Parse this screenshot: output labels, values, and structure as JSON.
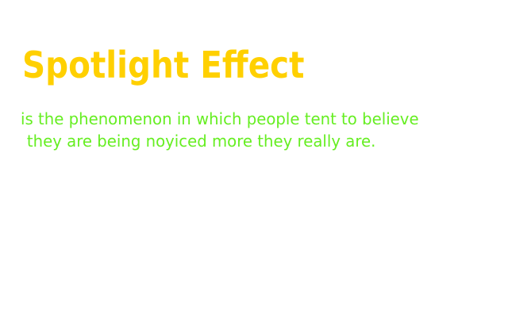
{
  "slide": {
    "title": "Spotlight Effect",
    "body_lines": [
      "is the phenomenon in which people tent to believe",
      "they are being noyiced more they really are."
    ],
    "colors": {
      "background": "#ffffff",
      "title": "#ffd000",
      "body": "#66ee22"
    }
  }
}
